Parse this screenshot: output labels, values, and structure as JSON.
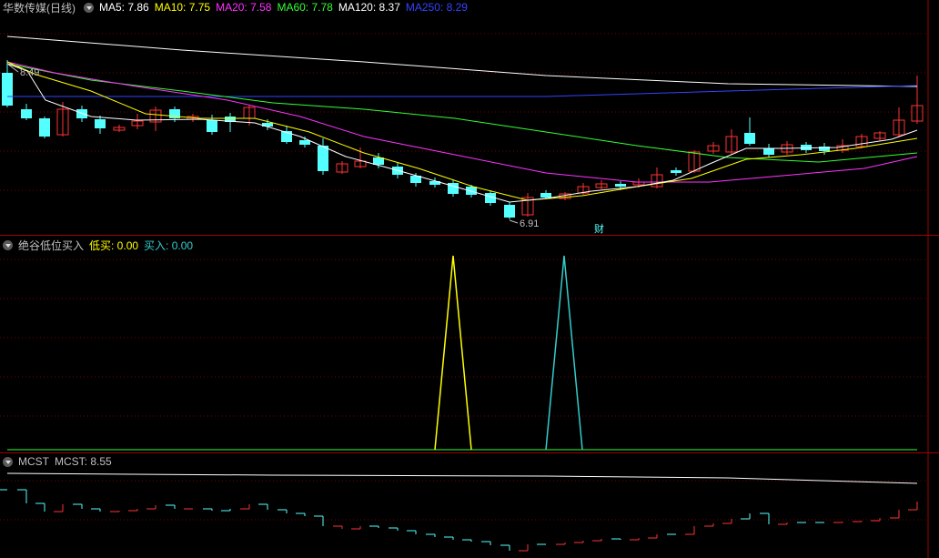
{
  "main": {
    "title": "华数传媒(日线)",
    "ma": [
      {
        "label": "MA5: 7.86",
        "color": "#ffffff"
      },
      {
        "label": "MA10: 7.75",
        "color": "#ffff00"
      },
      {
        "label": "MA20: 7.58",
        "color": "#ff33ff"
      },
      {
        "label": "MA60: 7.78",
        "color": "#33ff33"
      },
      {
        "label": "MA120: 8.37",
        "color": "#ffffff"
      },
      {
        "label": "MA250: 8.29",
        "color": "#3344ff"
      }
    ],
    "high_label": "8.49",
    "low_label": "6.91",
    "event_marker": "财"
  },
  "indicator1": {
    "name": "绝谷低位买入",
    "low_buy": "低买: 0.00",
    "buy": "买入: 0.00",
    "low_buy_color": "#ffff00",
    "buy_color": "#33cccc"
  },
  "indicator2": {
    "name": "MCST",
    "value": "MCST: 8.55"
  },
  "colors": {
    "up": "#ff3333",
    "down": "#54ffff",
    "grid": "#7a0000",
    "border": "#a00000"
  }
}
